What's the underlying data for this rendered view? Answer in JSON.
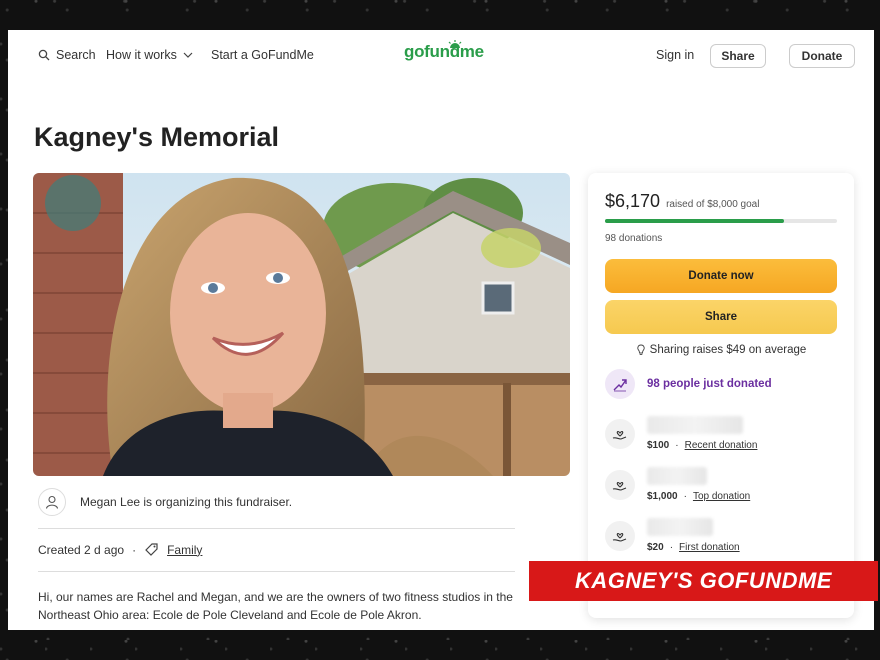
{
  "header": {
    "search_label": "Search",
    "how_it_works_label": "How it works",
    "start_label": "Start a GoFundMe",
    "logo_text": "gofundme",
    "sign_in_label": "Sign in",
    "share_label": "Share",
    "donate_label": "Donate"
  },
  "campaign": {
    "title": "Kagney's Memorial",
    "organizer_text": "Megan Lee is organizing this fundraiser.",
    "created_text": "Created 2 d ago",
    "category": "Family",
    "story": "Hi, our names are Rachel and Megan, and we are the owners of two fitness studios in the Northeast Ohio area: Ecole de Pole Cleveland and Ecole de Pole Akron."
  },
  "donation_card": {
    "raised_amount": "$6,170",
    "goal_text": "raised of $8,000 goal",
    "progress_fraction": 0.77,
    "donations_count": "98 donations",
    "donate_now_label": "Donate now",
    "share_label": "Share",
    "sharing_text": "Sharing raises $49 on average",
    "trend_text": "98 people just donated",
    "donations": [
      {
        "amount": "$100",
        "label": "Recent donation"
      },
      {
        "amount": "$1,000",
        "label": "Top donation"
      },
      {
        "amount": "$20",
        "label": "First donation"
      }
    ]
  },
  "overlay_banner": "KAGNEY'S GOFUNDME",
  "colors": {
    "brand_green": "#2a9d4a",
    "donate_orange": "#f6a723",
    "share_yellow": "#f6c94f",
    "trend_purple": "#6b2fa0",
    "banner_red": "#d81818"
  }
}
